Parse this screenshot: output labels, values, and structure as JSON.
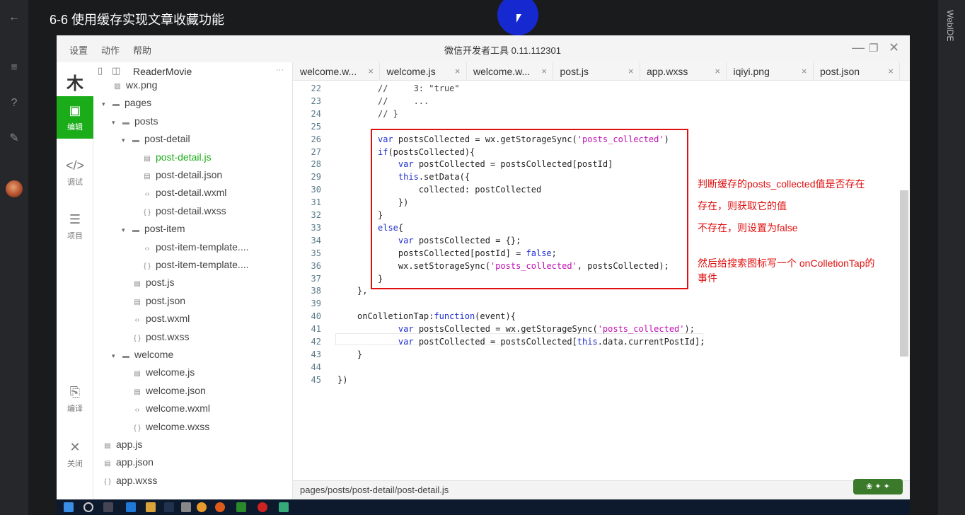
{
  "player": {
    "title": "6-6 使用缓存实现文章收藏功能",
    "right_label": "WebIDE"
  },
  "window": {
    "app_title": "微信开发者工具 0.11.112301",
    "menus": [
      "设置",
      "动作",
      "帮助"
    ]
  },
  "activitybar": [
    {
      "icon": "code-icon",
      "label": "编辑",
      "active": true
    },
    {
      "icon": "debug-icon",
      "label": "调试",
      "active": false
    },
    {
      "icon": "project-icon",
      "label": "项目",
      "active": false
    },
    {
      "icon": "compile-icon",
      "label": "编译",
      "active": false
    },
    {
      "icon": "close-icon",
      "label": "关闭",
      "active": false
    }
  ],
  "filetree": {
    "project": "ReaderMovie",
    "more": "···",
    "rows": [
      {
        "label": "wx.png",
        "type": "file",
        "icon": "img"
      },
      {
        "label": "pages",
        "type": "folder"
      },
      {
        "label": "posts",
        "type": "folder"
      },
      {
        "label": "post-detail",
        "type": "folder"
      },
      {
        "label": "post-detail.js",
        "type": "file",
        "icon": "JS",
        "selected": true
      },
      {
        "label": "post-detail.json",
        "type": "file",
        "icon": "JS"
      },
      {
        "label": "post-detail.wxml",
        "type": "file",
        "icon": "<>"
      },
      {
        "label": "post-detail.wxss",
        "type": "file",
        "icon": "{}"
      },
      {
        "label": "post-item",
        "type": "folder"
      },
      {
        "label": "post-item-template....",
        "type": "file",
        "icon": "<>"
      },
      {
        "label": "post-item-template....",
        "type": "file",
        "icon": "{}"
      },
      {
        "label": "post.js",
        "type": "file",
        "icon": "JS"
      },
      {
        "label": "post.json",
        "type": "file",
        "icon": "JS"
      },
      {
        "label": "post.wxml",
        "type": "file",
        "icon": "<>"
      },
      {
        "label": "post.wxss",
        "type": "file",
        "icon": "{}"
      },
      {
        "label": "welcome",
        "type": "folder"
      },
      {
        "label": "welcome.js",
        "type": "file",
        "icon": "JS"
      },
      {
        "label": "welcome.json",
        "type": "file",
        "icon": "JS"
      },
      {
        "label": "welcome.wxml",
        "type": "file",
        "icon": "<>"
      },
      {
        "label": "welcome.wxss",
        "type": "file",
        "icon": "{}"
      },
      {
        "label": "app.js",
        "type": "file",
        "icon": "JS"
      },
      {
        "label": "app.json",
        "type": "file",
        "icon": "JS"
      },
      {
        "label": "app.wxss",
        "type": "file",
        "icon": "{}"
      }
    ]
  },
  "tabs": [
    {
      "label": "welcome.w...",
      "close": "×"
    },
    {
      "label": "welcome.js",
      "close": "×"
    },
    {
      "label": "welcome.w...",
      "close": "×"
    },
    {
      "label": "post.js",
      "close": "×"
    },
    {
      "label": "app.wxss",
      "close": "×"
    },
    {
      "label": "iqiyi.png",
      "close": "×"
    },
    {
      "label": "post.json",
      "close": "×"
    }
  ],
  "code_lines": [
    {
      "n": "22",
      "text": "//     3: \"true\""
    },
    {
      "n": "23",
      "text": "//     ..."
    },
    {
      "n": "24",
      "text": "// }"
    },
    {
      "n": "25",
      "text": ""
    },
    {
      "n": "26",
      "text": "var postsCollected = wx.getStorageSync('posts_collected')"
    },
    {
      "n": "27",
      "text": "if(postsCollected){"
    },
    {
      "n": "28",
      "text": "    var postCollected = postsCollected[postId]"
    },
    {
      "n": "29",
      "text": "    this.setData({"
    },
    {
      "n": "30",
      "text": "        collected: postCollected"
    },
    {
      "n": "31",
      "text": "    })"
    },
    {
      "n": "32",
      "text": "}"
    },
    {
      "n": "33",
      "text": "else{"
    },
    {
      "n": "34",
      "text": "    var postsCollected = {};"
    },
    {
      "n": "35",
      "text": "    postsCollected[postId] = false;"
    },
    {
      "n": "36",
      "text": "    wx.setStorageSync('posts_collected', postsCollected);"
    },
    {
      "n": "37",
      "text": "}"
    },
    {
      "n": "38",
      "text": "},"
    },
    {
      "n": "39",
      "text": ""
    },
    {
      "n": "40",
      "text": "onColletionTap:function(event){"
    },
    {
      "n": "41",
      "text": "    var postsCollected = wx.getStorageSync('posts_collected');"
    },
    {
      "n": "42",
      "text": "    var postCollected = postsCollected[this.data.currentPostId];"
    },
    {
      "n": "43",
      "text": "}"
    },
    {
      "n": "44",
      "text": ""
    },
    {
      "n": "45",
      "text": "})"
    }
  ],
  "annotations": [
    "判断缓存的posts_collected值是否存在",
    "存在，则获取它的值",
    "不存在，则设置为false",
    "然后给搜索图标写一个 onColletionTap的",
    "事件"
  ],
  "statusbar": {
    "path": "pages/posts/post-detail/post-detail.js"
  },
  "colors": {
    "accent_green": "#1aad19",
    "annotation_red": "#e01010",
    "keyword_blue": "#2030d0",
    "string_magenta": "#c010b0"
  }
}
